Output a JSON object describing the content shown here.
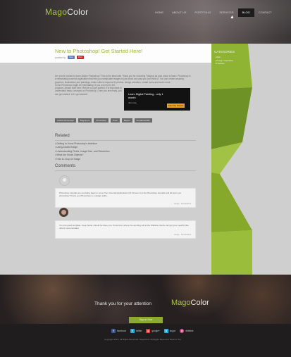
{
  "header": {
    "logo_part1": "Mago",
    "logo_part2": "Color",
    "nav": [
      "HOME",
      "ABOUT US",
      "PORTFOLIO",
      "SERVICES",
      "BLOG",
      "CONTACT"
    ],
    "active_nav": "BLOG"
  },
  "post": {
    "title": "New to Photoshop! Get Started Here!",
    "meta_text": "posted by",
    "like_label": "Like",
    "pin_label": "Pinit",
    "intro_lead": "Are you'te excited to learn Adobe Photoshop? This is the ideal site! Thank you for choosing Tutsplus as your place to learn. Photoshop is a remarkably powerful application that lets you manipulate images in just about any way you can think of. You can create amazing graphics, illustrations and paintings, make edits to improve fix photos, design websites, create icons and much more.",
    "intro_more": "Some Photoshop might be intimidating. If you are new to the program, please start here. Before you get started, it is important to understand basic concepts on Photoshop. Once you are ready, you can get started. Let's get started!",
    "tags": [
      "Adobe Photoshop",
      "Beginners",
      "Photoshop",
      "Tools",
      "Basics",
      "Fundamentals"
    ]
  },
  "ad": {
    "title": "Learn Digital Painting - only 1 month",
    "subtitle": "Join now",
    "button": "Start the Wizard"
  },
  "related": {
    "title": "Related",
    "items": [
      "Getting to Know Photoshop's Interface",
      "Using Adobe Bridge",
      "Understanding Pixels, Image Size, and Resolution",
      "What Are Smart Objects?",
      "How to Crop an Image"
    ]
  },
  "comments": {
    "title": "Comments",
    "items": [
      {
        "text": "Photoshop tutorials are providing basic to some from Internal Applications (I'll Chosen it is the Photoshop tutorials and all learn you photoshop! Thank you Photoshop is a design skills...",
        "reply": "Reply - 10/14/2014"
      },
      {
        "text": "It is one good template. Keep better should be done you. Know that, where the wording will at the Website clients can get your specific like, others must consider.",
        "reply": "Reply - 10/14/2014"
      }
    ]
  },
  "sidebar": {
    "title": "CATEGORIES",
    "items": [
      "Web",
      "Design Inspiration",
      "Freebies"
    ]
  },
  "footer": {
    "thanks": "Thank you for your attention",
    "logo_part1": "Mago",
    "logo_part2": "Color",
    "signup": "Sign in Now",
    "social": [
      {
        "name": "facebook",
        "label": "facebook"
      },
      {
        "name": "twitter",
        "label": "twitter"
      },
      {
        "name": "google",
        "label": "google+"
      },
      {
        "name": "skype",
        "label": "skype"
      },
      {
        "name": "dribbble",
        "label": "dribbble"
      }
    ],
    "copyright": "Copyright 2013, All Rights Reserved. MagoColor All Rights Reserved. Back to Top"
  },
  "colors": {
    "accent": "#8cab2e",
    "brand_green": "#a7c442",
    "dark": "#1f1d1e"
  }
}
